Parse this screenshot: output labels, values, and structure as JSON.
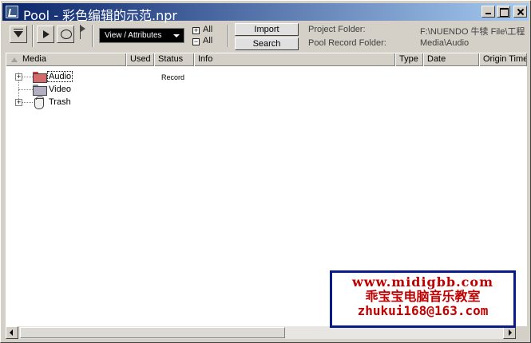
{
  "window": {
    "title": "Pool - 彩色编辑的示范.npr"
  },
  "toolbar": {
    "view_select": "View / Attributes",
    "expand_all": "All",
    "collapse_all": "All",
    "import_label": "Import",
    "search_label": "Search",
    "project_folder_label": "Project Folder:",
    "project_folder_value": "F:\\NUENDO 牛犊  File\\工程",
    "pool_record_folder_label": "Pool Record Folder:",
    "pool_record_folder_value": "Media\\Audio"
  },
  "columns": [
    "Media",
    "Used",
    "Status",
    "Info",
    "Type",
    "Date",
    "Origin Time"
  ],
  "rows": [
    {
      "label": "Audio",
      "status": "Record",
      "icon": "audio-folder-icon",
      "expander": "+"
    },
    {
      "label": "Video",
      "icon": "video-folder-icon"
    },
    {
      "label": "Trash",
      "icon": "trash-icon",
      "expander": "+"
    }
  ],
  "watermark": {
    "line1": "www.midigbb.com",
    "line2": "乖宝宝电脑音乐教室",
    "line3": "zhukui168@163.com"
  },
  "colors": {
    "titlebar_start": "#0a246a",
    "titlebar_end": "#a6caf0",
    "watermark_text": "#c00000",
    "watermark_border": "#0a1a8a"
  }
}
